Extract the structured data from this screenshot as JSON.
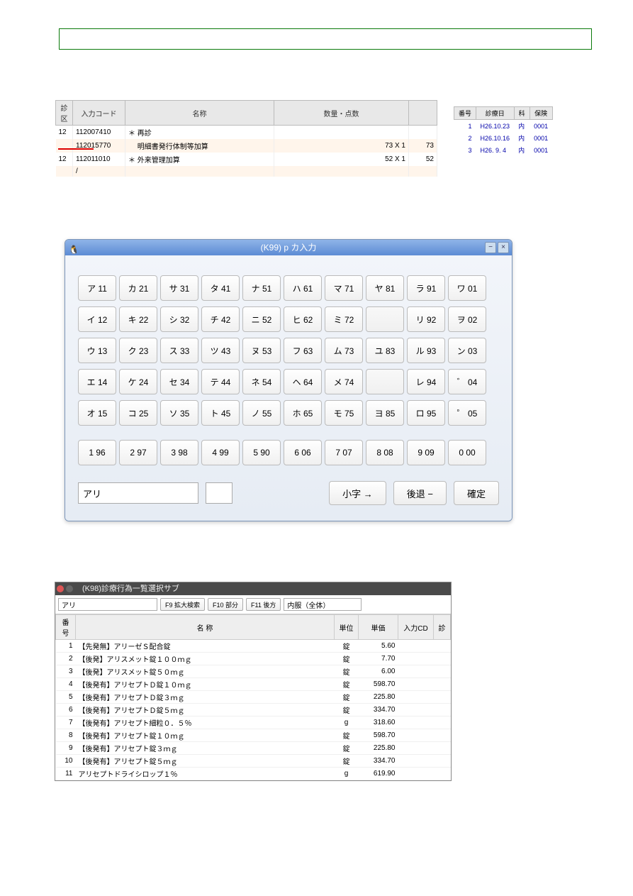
{
  "top_table": {
    "headers": [
      "診区",
      "入力コード",
      "名称",
      "数量・点数"
    ],
    "rows": [
      {
        "c1": "12",
        "c2": "112007410",
        "c3": "＊ 再診",
        "c4": "",
        "c5": ""
      },
      {
        "c1": "",
        "c2": "112015770",
        "c3": "　 明細書発行体制等加算",
        "c4": "73 X 1",
        "c5": "73"
      },
      {
        "c1": "12",
        "c2": "112011010",
        "c3": "＊ 外来管理加算",
        "c4": "52 X 1",
        "c5": "52"
      },
      {
        "c1": "",
        "c2": "/",
        "c3": "",
        "c4": "",
        "c5": ""
      }
    ]
  },
  "history": {
    "headers": [
      "番号",
      "診療日",
      "科",
      "保険"
    ],
    "rows": [
      {
        "n": "1",
        "d": "H26.10.23",
        "k": "内",
        "h": "0001"
      },
      {
        "n": "2",
        "d": "H26.10.16",
        "k": "内",
        "h": "0001"
      },
      {
        "n": "3",
        "d": "H26. 9. 4",
        "k": "内",
        "h": "0001"
      }
    ]
  },
  "dialog": {
    "title": "(K99) p カ入力",
    "grid": [
      [
        {
          "t": "ア 11"
        },
        {
          "t": "カ 21"
        },
        {
          "t": "サ 31"
        },
        {
          "t": "タ 41"
        },
        {
          "t": "ナ 51"
        },
        {
          "t": "ハ 61"
        },
        {
          "t": "マ 71"
        },
        {
          "t": "ヤ 81"
        },
        {
          "t": "ラ 91"
        },
        {
          "t": "ワ 01"
        }
      ],
      [
        {
          "t": "イ 12"
        },
        {
          "t": "キ 22"
        },
        {
          "t": "シ 32"
        },
        {
          "t": "チ 42"
        },
        {
          "t": "ニ 52"
        },
        {
          "t": "ヒ 62"
        },
        {
          "t": "ミ 72"
        },
        {
          "t": ""
        },
        {
          "t": "リ 92"
        },
        {
          "t": "ヲ 02"
        }
      ],
      [
        {
          "t": "ウ 13"
        },
        {
          "t": "ク 23"
        },
        {
          "t": "ス 33"
        },
        {
          "t": "ツ 43"
        },
        {
          "t": "ヌ 53"
        },
        {
          "t": "フ 63"
        },
        {
          "t": "ム 73"
        },
        {
          "t": "ユ 83"
        },
        {
          "t": "ル 93"
        },
        {
          "t": "ン 03"
        }
      ],
      [
        {
          "t": "エ 14"
        },
        {
          "t": "ケ 24"
        },
        {
          "t": "セ 34"
        },
        {
          "t": "テ 44"
        },
        {
          "t": "ネ 54"
        },
        {
          "t": "ヘ 64"
        },
        {
          "t": "メ 74"
        },
        {
          "t": ""
        },
        {
          "t": "レ 94"
        },
        {
          "t": "゛  04"
        }
      ],
      [
        {
          "t": "オ 15"
        },
        {
          "t": "コ 25"
        },
        {
          "t": "ソ 35"
        },
        {
          "t": "ト 45"
        },
        {
          "t": "ノ 55"
        },
        {
          "t": "ホ 65"
        },
        {
          "t": "モ 75"
        },
        {
          "t": "ヨ 85"
        },
        {
          "t": "ロ 95"
        },
        {
          "t": "゜  05"
        }
      ]
    ],
    "num_row": [
      {
        "t": "1 96"
      },
      {
        "t": "2 97"
      },
      {
        "t": "3 98"
      },
      {
        "t": "4 99"
      },
      {
        "t": "5 90"
      },
      {
        "t": "6 06"
      },
      {
        "t": "7 07"
      },
      {
        "t": "8 08"
      },
      {
        "t": "9 09"
      },
      {
        "t": "0 00"
      }
    ],
    "input_value": "アリ",
    "btn_small": "小字 →",
    "btn_back": "後退 −",
    "btn_confirm": "確定"
  },
  "list": {
    "title": "(K98)診療行為一覧選択サブ",
    "search_value": "アリ",
    "btn_f9": "F9 拡大検索",
    "btn_f10": "F10 部分",
    "btn_f11": "F11 後方",
    "select_val": "内服（全体）",
    "headers": [
      "番号",
      "名 称",
      "単位",
      "単価",
      "入力CD",
      "診"
    ],
    "rows": [
      {
        "n": "1",
        "name": "【先発無】アリーゼＳ配合錠",
        "u": "錠",
        "p": "5.60"
      },
      {
        "n": "2",
        "name": "【後発】アリスメット錠１００ｍｇ",
        "u": "錠",
        "p": "7.70"
      },
      {
        "n": "3",
        "name": "【後発】アリスメット錠５０ｍｇ",
        "u": "錠",
        "p": "6.00"
      },
      {
        "n": "4",
        "name": "【後発有】アリセプトＤ錠１０ｍｇ",
        "u": "錠",
        "p": "598.70"
      },
      {
        "n": "5",
        "name": "【後発有】アリセプトＤ錠３ｍｇ",
        "u": "錠",
        "p": "225.80"
      },
      {
        "n": "6",
        "name": "【後発有】アリセプトＤ錠５ｍｇ",
        "u": "錠",
        "p": "334.70"
      },
      {
        "n": "7",
        "name": "【後発有】アリセプト細粒０．５％",
        "u": "g",
        "p": "318.60"
      },
      {
        "n": "8",
        "name": "【後発有】アリセプト錠１０ｍｇ",
        "u": "錠",
        "p": "598.70"
      },
      {
        "n": "9",
        "name": "【後発有】アリセプト錠３ｍｇ",
        "u": "錠",
        "p": "225.80"
      },
      {
        "n": "10",
        "name": "【後発有】アリセプト錠５ｍｇ",
        "u": "錠",
        "p": "334.70"
      },
      {
        "n": "11",
        "name": "アリセプトドライシロップ１％",
        "u": "g",
        "p": "619.90"
      }
    ]
  }
}
